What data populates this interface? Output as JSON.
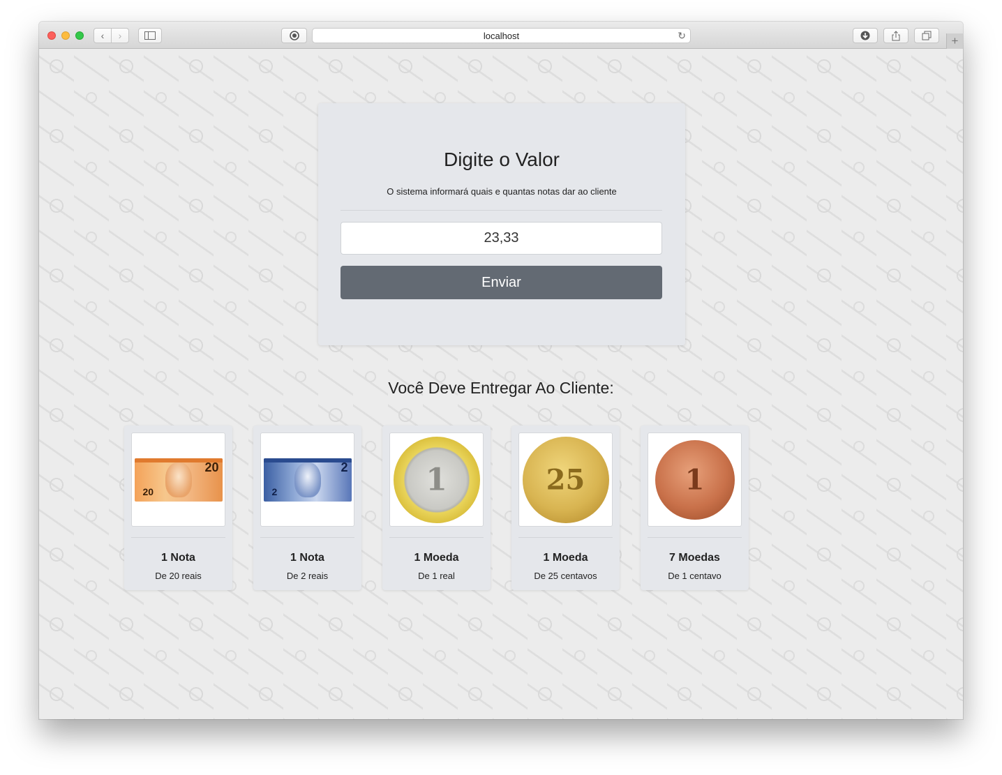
{
  "browser": {
    "url": "localhost",
    "icons": {
      "back": "chevron-left-icon",
      "forward": "chevron-right-icon",
      "sidebar": "sidebar-icon",
      "shield": "shield-icon",
      "reload": "reload-icon",
      "download": "download-icon",
      "share": "share-icon",
      "tabs": "tabs-icon",
      "new_tab": "plus-icon"
    }
  },
  "form": {
    "title": "Digite o Valor",
    "subtitle": "O sistema informará quais e quantas notas dar ao cliente",
    "input_value": "23,33",
    "submit_label": "Enviar"
  },
  "result": {
    "title": "Você Deve Entregar Ao Cliente:",
    "items": [
      {
        "quantity": "1 Nota",
        "description": "De 20 reais",
        "kind": "note",
        "face": "20",
        "color": "#f4a259"
      },
      {
        "quantity": "1 Nota",
        "description": "De 2 reais",
        "kind": "note",
        "face": "2",
        "color": "#3b5fa3"
      },
      {
        "quantity": "1 Moeda",
        "description": "De 1 real",
        "kind": "coin",
        "face": "1",
        "color": "#d4b630"
      },
      {
        "quantity": "1 Moeda",
        "description": "De 25 centavos",
        "kind": "coin",
        "face": "25",
        "color": "#d8b451"
      },
      {
        "quantity": "7 Moedas",
        "description": "De 1 centavo",
        "kind": "coin",
        "face": "1",
        "color": "#c9714a"
      }
    ]
  },
  "colors": {
    "card_bg": "#e5e7eb",
    "button_bg": "#636a73",
    "page_bg": "#ececec"
  }
}
